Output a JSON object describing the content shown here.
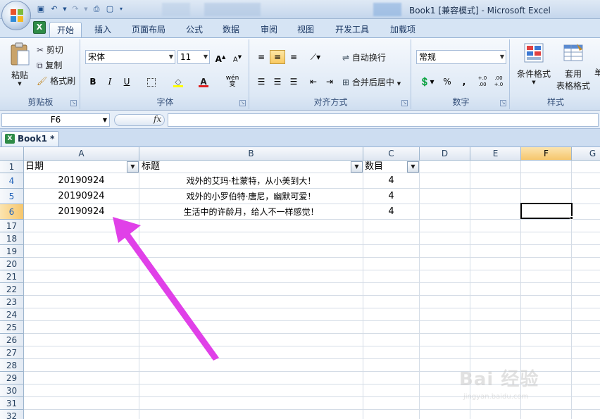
{
  "window": {
    "title": "Book1  [兼容模式] - Microsoft Excel"
  },
  "quick_access": {
    "icons": [
      "save-icon",
      "undo-icon",
      "redo-icon",
      "print-preview-icon",
      "new-document-icon",
      "customize-icon"
    ]
  },
  "tabs": [
    "开始",
    "插入",
    "页面布局",
    "公式",
    "数据",
    "审阅",
    "视图",
    "开发工具",
    "加载项"
  ],
  "ribbon": {
    "clipboard": {
      "label": "剪贴板",
      "paste": "粘贴",
      "cut": "剪切",
      "copy": "复制",
      "format_painter": "格式刷"
    },
    "font": {
      "label": "字体",
      "font_name": "宋体",
      "font_size": "11",
      "bold": "B",
      "italic": "I",
      "underline": "U",
      "phonetic": "wén 变"
    },
    "alignment": {
      "label": "对齐方式",
      "wrap_text": "自动换行",
      "merge_center": "合并后居中"
    },
    "number": {
      "label": "数字",
      "format": "常规",
      "percent": "%",
      "comma": ",",
      "inc_dec": "+.0 .00",
      "dec_dec": ".00 +.0"
    },
    "styles": {
      "label": "样式",
      "conditional_format": "条件格式",
      "format_as_table_1": "套用",
      "format_as_table_2": "表格格式",
      "cell_styles": "单"
    }
  },
  "formula_bar": {
    "name_box": "F6",
    "fx": "fx",
    "formula": ""
  },
  "workbook": {
    "tab_label": "Book1 *"
  },
  "sheet": {
    "selected_cell": "F6",
    "columns": [
      "A",
      "B",
      "C",
      "D",
      "E",
      "F",
      "G"
    ],
    "header_row": {
      "row": "1",
      "a": "日期",
      "b": "标题",
      "c": "数目"
    },
    "data_rows": [
      {
        "row": "4",
        "a": "20190924",
        "b": "戏外的艾玛·杜蒙特，从小美到大！",
        "c": "4"
      },
      {
        "row": "5",
        "a": "20190924",
        "b": "戏外的小罗伯特·唐尼，幽默可爱！",
        "c": "4"
      },
      {
        "row": "6",
        "a": "20190924",
        "b": "生活中的许龄月，给人不一样感觉！",
        "c": "4"
      }
    ],
    "empty_rows": [
      "17",
      "18",
      "19",
      "20",
      "21",
      "22",
      "23",
      "24",
      "25",
      "26",
      "27",
      "28",
      "29",
      "30",
      "31",
      "32"
    ]
  },
  "annotation": {
    "color": "#e040e8"
  },
  "watermark": {
    "main": "Bai 经验",
    "sub": "jingyan.baidu.com"
  },
  "colors": {
    "accent": "#f6c66c",
    "ribbon": "#dde8f5",
    "excel_green": "#2e8b47"
  }
}
